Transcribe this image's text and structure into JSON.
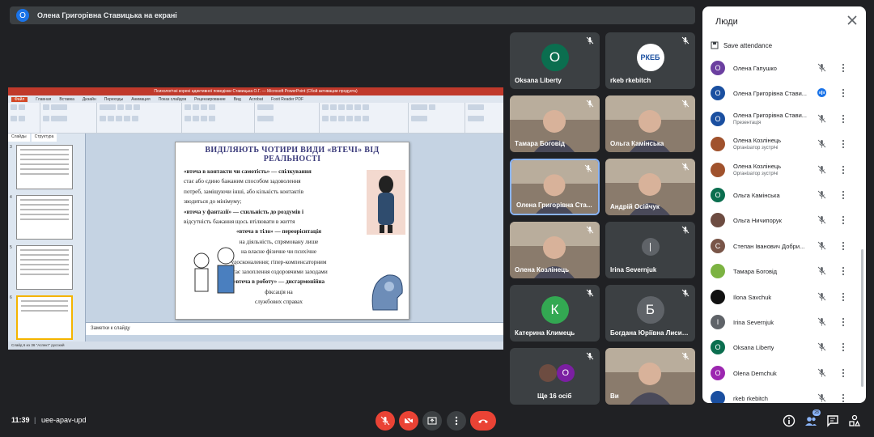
{
  "presenter_bar": {
    "avatar_letter": "О",
    "text": "Олена Григорівна Ставицька на екрані"
  },
  "shared_screen": {
    "window_title": "Психологічні корені адиктивної поведінки Ставицька О.Г. — Microsoft PowerPoint (Сбой активации продукта)",
    "ribbon_tabs": [
      "Файл",
      "Главная",
      "Вставка",
      "Дизайн",
      "Переходы",
      "Анимация",
      "Показ слайдов",
      "Рецензирование",
      "Вид",
      "Acrobat",
      "Foxit Reader PDF"
    ],
    "panel_tabs": [
      "Слайды",
      "Структура"
    ],
    "slide_numbers": [
      "3",
      "4",
      "5",
      "6"
    ],
    "slide": {
      "heading": "ВИДІЛЯЮТЬ ЧОТИРИ ВИДИ «ВТЕЧІ» ВІД РЕАЛЬНОСТІ",
      "lines": [
        "«втеча в контакти чи самотість» — спілкування",
        "стає або єдино бажаним способом задоволення",
        "потреб, заміщуючи інші, або кількість контактів",
        "зводиться до мінімуму;",
        "«втеча у фантазії» — схильність до роздумів і",
        "відсутність бажання щось втілювати в життя",
        "«втеча в тіло» — переорієнтація",
        "на діяльність, спрямовану лише",
        "на власне фізичне чи психічне",
        "удосконалення; гіпер-компенсаторним",
        "стає захоплення оздоровчими заходами",
        "«втеча в роботу» — дисгармонійна",
        "фіксація на",
        "службових справах"
      ]
    },
    "notes_placeholder": "Заметки к слайду",
    "status_text": "Слайд 6 из 36   \"Аспект\"   русский"
  },
  "tiles": [
    {
      "name": "Oksana Liberty",
      "letter": "O",
      "color": "#0b6e4f",
      "type": "avatar"
    },
    {
      "name": "rkeb rkebitch",
      "letter": "РКЕБ",
      "color": "#1a4fa0",
      "type": "logo"
    },
    {
      "name": "Тамара Боговід",
      "type": "photo"
    },
    {
      "name": "Ольга Камінська",
      "type": "photo"
    },
    {
      "name": "Олена Григорівна Ста...",
      "type": "photo",
      "active": true
    },
    {
      "name": "Андрій Осійчук",
      "type": "photo"
    },
    {
      "name": "Олена Козлінець",
      "type": "photo"
    },
    {
      "name": "Irina Severnjuk",
      "type": "empty"
    },
    {
      "name": "Катерина Климець",
      "letter": "К",
      "color": "#33a852",
      "type": "avatar"
    },
    {
      "name": "Богдана Юріївна Лисиц...",
      "letter": "Б",
      "color": "#5f6368",
      "type": "avatar"
    },
    {
      "name": "Ще 16 осіб",
      "type": "more"
    },
    {
      "name": "Ви",
      "type": "photo"
    }
  ],
  "people_panel": {
    "title": "Люди",
    "save_attendance": "Save attendance",
    "people": [
      {
        "name": "Олена Гапушко",
        "role": "",
        "letter": "О",
        "color": "#6b3fa0"
      },
      {
        "name": "Олена Григорівна Стави...",
        "role": "",
        "letter": "О",
        "color": "#1a4fa0",
        "speaking": true
      },
      {
        "name": "Олена Григорівна Стави...",
        "role": "Презентація",
        "letter": "О",
        "color": "#1a4fa0"
      },
      {
        "name": "Олена Козлінець",
        "role": "Організатор зустрічі",
        "letter": "",
        "color": "#a0522d"
      },
      {
        "name": "Олена Козлінець",
        "role": "Організатор зустрічі",
        "letter": "",
        "color": "#a0522d"
      },
      {
        "name": "Ольга Камінська",
        "role": "",
        "letter": "О",
        "color": "#0b6e4f"
      },
      {
        "name": "Ольга Ничипорук",
        "role": "",
        "letter": "",
        "color": "#6d4c41"
      },
      {
        "name": "Степан Іванович Добри...",
        "role": "",
        "letter": "С",
        "color": "#795548"
      },
      {
        "name": "Тамара Боговід",
        "role": "",
        "letter": "",
        "color": "#7cb342"
      },
      {
        "name": "Ilona Savchuk",
        "role": "",
        "letter": "",
        "color": "#111111"
      },
      {
        "name": "Irina Severnjuk",
        "role": "",
        "letter": "I",
        "color": "#5f6368"
      },
      {
        "name": "Oksana Liberty",
        "role": "",
        "letter": "O",
        "color": "#0b6e4f"
      },
      {
        "name": "Olena Demchuk",
        "role": "",
        "letter": "O",
        "color": "#9c27b0"
      },
      {
        "name": "rkeb rkebitch",
        "role": "",
        "letter": "",
        "color": "#1a4fa0"
      }
    ]
  },
  "bottom_bar": {
    "time": "11:39",
    "meeting_code": "uee-apav-upd",
    "participants_count": "28"
  }
}
